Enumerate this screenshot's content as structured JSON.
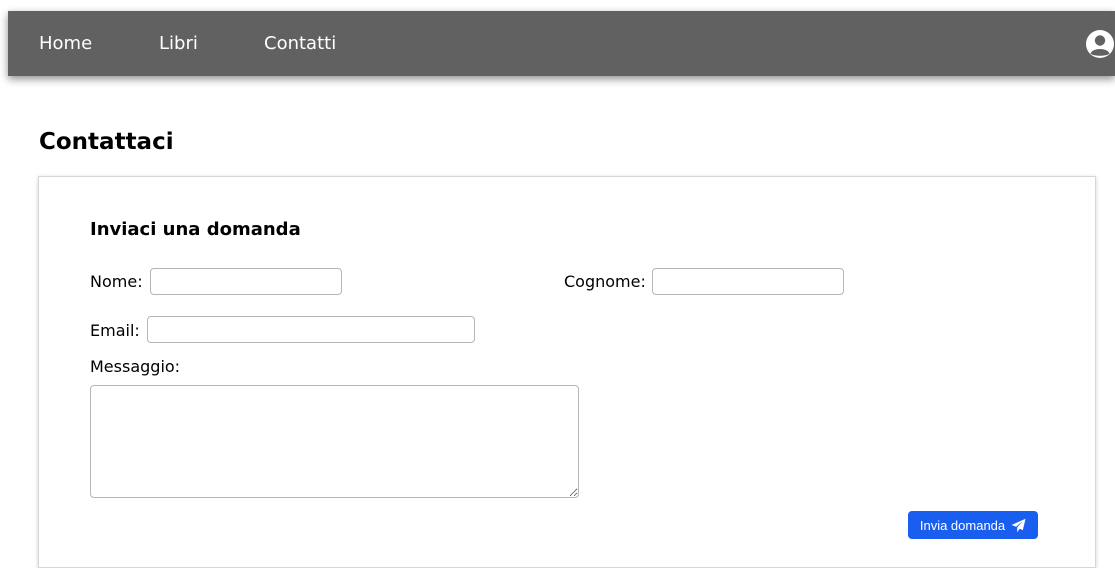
{
  "nav": {
    "items": [
      {
        "label": "Home"
      },
      {
        "label": "Libri"
      },
      {
        "label": "Contatti"
      }
    ],
    "user_icon": "user-circle-icon"
  },
  "page": {
    "title": "Contattaci"
  },
  "form": {
    "title": "Inviaci una domanda",
    "nome_label": "Nome:",
    "nome_value": "",
    "cognome_label": "Cognome:",
    "cognome_value": "",
    "email_label": "Email:",
    "email_value": "",
    "messaggio_label": "Messaggio:",
    "messaggio_value": "",
    "submit_label": "Invia domanda",
    "submit_icon": "paper-plane-icon"
  },
  "colors": {
    "navbar": "#616161",
    "button": "#1a5ef0"
  }
}
